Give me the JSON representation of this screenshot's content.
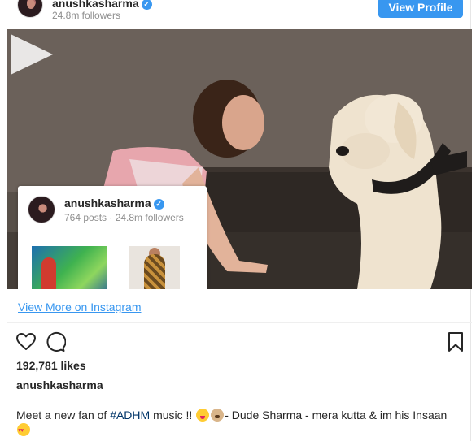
{
  "header": {
    "username": "anushkasharma",
    "followers": "24.8m followers",
    "view_profile_label": "View Profile"
  },
  "preview": {
    "username": "anushkasharma",
    "stats": "764 posts · 24.8m followers"
  },
  "view_more_label": "View More on Instagram",
  "likes": "192,781 likes",
  "owner": "anushkasharma",
  "caption": {
    "before": "Meet a new fan of ",
    "hashtag": "#ADHM",
    "middle": " music !! ",
    "after": "- Dude Sharma - mera kutta & im his Insaan"
  },
  "icons": {
    "verified": "verified-badge-icon",
    "play": "play-icon",
    "like": "heart-icon",
    "comment": "comment-icon",
    "save": "bookmark-icon"
  },
  "colors": {
    "accent": "#3897f0",
    "hashtag": "#003569",
    "text": "#262626",
    "muted": "#8e8e8e"
  }
}
